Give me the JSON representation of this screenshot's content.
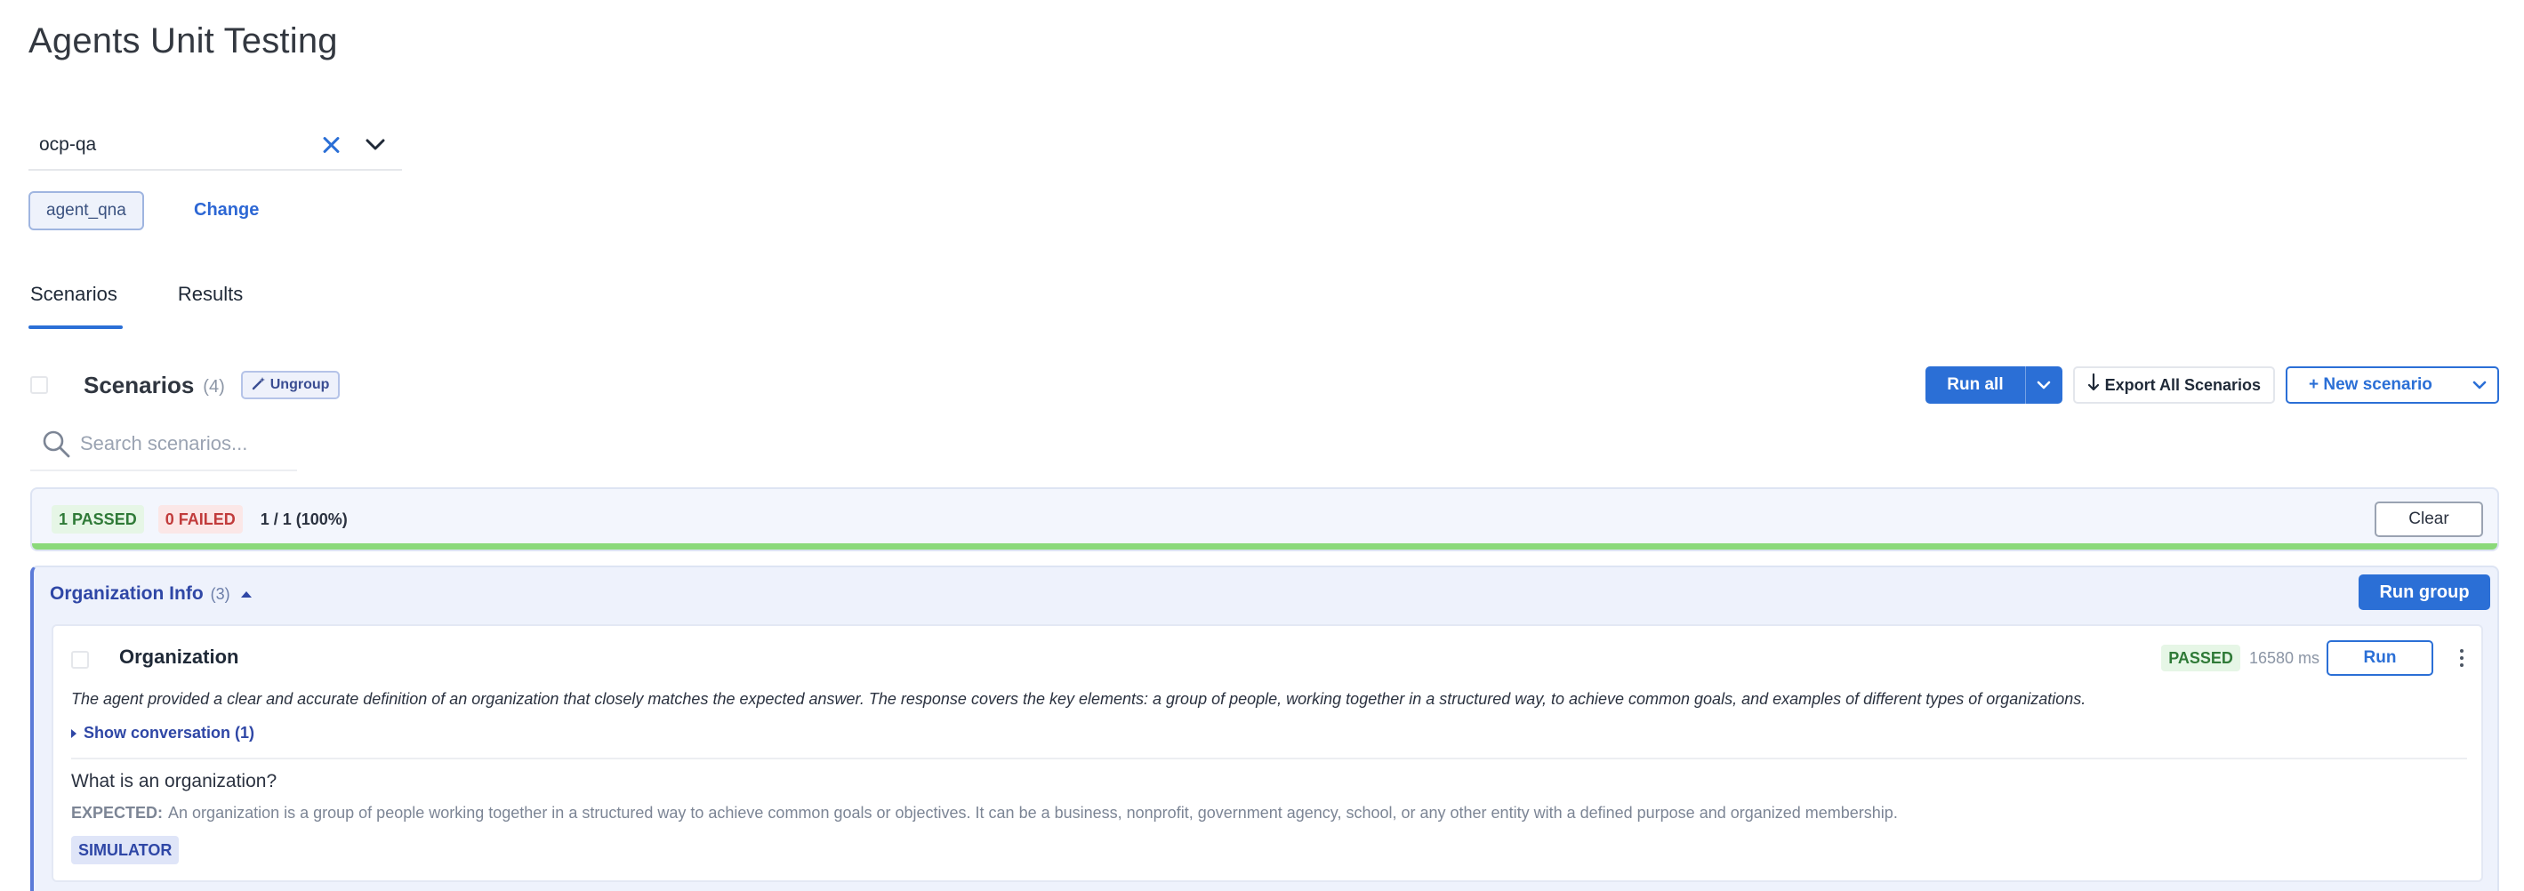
{
  "page": {
    "title": "Agents Unit Testing"
  },
  "project_select": {
    "value": "ocp-qa"
  },
  "agent": {
    "chip_label": "agent_qna",
    "change_label": "Change"
  },
  "tabs": [
    {
      "label": "Scenarios",
      "active": true
    },
    {
      "label": "Results",
      "active": false
    }
  ],
  "scenarios_header": {
    "title": "Scenarios",
    "count": "(4)",
    "ungroup_label": "Ungroup",
    "run_all_label": "Run all",
    "export_label": "Export All Scenarios",
    "new_scenario_label": "+ New scenario"
  },
  "search": {
    "placeholder": "Search scenarios..."
  },
  "summary": {
    "passed": "1 PASSED",
    "failed": "0 FAILED",
    "ratio": "1 / 1 (100%)",
    "progress_fraction": 1.0,
    "clear_label": "Clear"
  },
  "group": {
    "name": "Organization Info",
    "count": "(3)",
    "run_group_label": "Run group",
    "scenario": {
      "title": "Organization",
      "status": "PASSED",
      "duration": "16580 ms",
      "run_label": "Run",
      "reasoning": "The agent provided a clear and accurate definition of an organization that closely matches the expected answer. The response covers the key elements: a group of people, working together in a structured way, to achieve common goals, and examples of different types of organizations.",
      "show_conversation": "Show conversation (1)",
      "question": "What is an organization?",
      "expected_label": "EXPECTED:",
      "expected_text": "An organization is a group of people working together in a structured way to achieve common goals or objectives. It can be a business, nonprofit, government agency, school, or any other entity with a defined purpose and organized membership.",
      "badge": "SIMULATOR"
    }
  },
  "colors": {
    "accent": "#2b6fd6",
    "pass_bg": "#e6f6e6",
    "pass_text": "#2f7a37",
    "fail_bg": "#fbe7e7",
    "fail_text": "#c13b3b",
    "progress": "#8bd97a"
  },
  "icons": {
    "clear": "close-icon",
    "dropdown": "chevron-down-icon",
    "ungroup": "magic-wand-icon",
    "export": "download-arrow-icon",
    "search": "search-icon",
    "menu": "kebab-menu-icon"
  }
}
